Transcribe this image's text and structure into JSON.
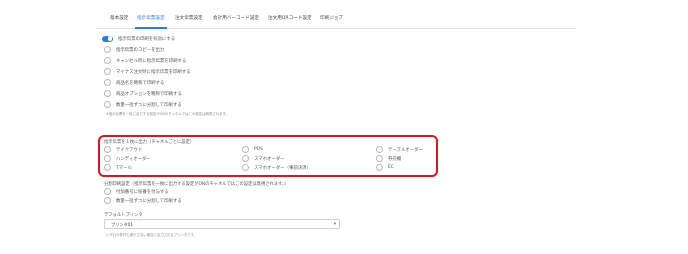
{
  "tabs": [
    {
      "label": "基本設定"
    },
    {
      "label": "指示伝票設定"
    },
    {
      "label": "注文伝票設定"
    },
    {
      "label": "会計用バーコード設定"
    },
    {
      "label": "注文用QRコード設定"
    },
    {
      "label": "印刷ジョブ"
    }
  ],
  "options": [
    {
      "label": "指示伝票の印刷を有効にする",
      "enabled": true
    },
    {
      "label": "指示伝票のコピーを出力"
    },
    {
      "label": "キャンセル時に指示伝票を印刷する"
    },
    {
      "label": "マイナス注文時に指示伝票を印刷する"
    },
    {
      "label": "商品名を略称で印刷する"
    },
    {
      "label": "商品オプションを略称で印刷する"
    },
    {
      "label": "数量一括ずつに分割して印刷する"
    }
  ],
  "note1": "※指示伝票を一枚に出力する設定がONのチャネルではこの設定は無視されます。",
  "channel_section": {
    "title": "指示伝票を１枚に出力（チャネルごとに設定）",
    "items": [
      "テイクアウト",
      "POS",
      "テーブルオーダー",
      "ハンディオーダー",
      "スマホオーダー",
      "券売機",
      "Tマール",
      "スマホオーダー（事前決済）",
      "EC"
    ]
  },
  "split_section": {
    "title": "分割印刷設定（指示伝票を一枚に出力する設定がONのチャネルではこの設定は無視されます。）",
    "options": [
      "付加番号に枝番を付与する",
      "数量一括ずつに分割して印刷する"
    ]
  },
  "printer": {
    "label": "デフォルトプリンタ",
    "value": "プリンタ01",
    "note": "いずれの条件も満たさない場合に出力されるプリンタです。"
  }
}
